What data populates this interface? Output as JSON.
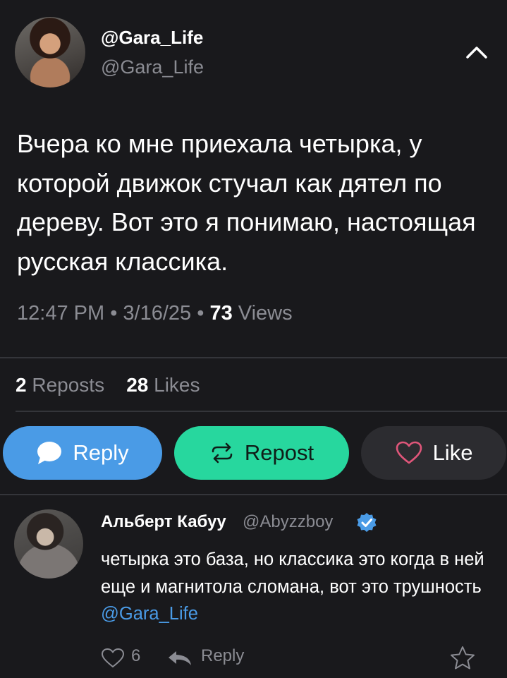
{
  "post": {
    "display_name": "@Gara_Life",
    "handle": "@Gara_Life",
    "text": "Вчера ко мне приехала четырка, у которой движок стучал как дятел по дереву. Вот это я понимаю, настоящая русская классика.",
    "time": "12:47 PM",
    "date": "3/16/25",
    "views_count": "73",
    "views_label": "Views",
    "separator": "•"
  },
  "stats": {
    "reposts_count": "2",
    "reposts_label": "Reposts",
    "likes_count": "28",
    "likes_label": "Likes"
  },
  "actions": {
    "reply_label": "Reply",
    "repost_label": "Repost",
    "like_label": "Like"
  },
  "comment": {
    "name": "Альберт Кабуу",
    "handle": "@Abyzzboy",
    "text_before_mention": "четырка это база, но классика это когда в ней еще и магнитола сломана, вот это трушность ",
    "mention": "@Gara_Life",
    "likes_count": "6",
    "reply_label": "Reply"
  },
  "icons": {
    "collapse": "chevron-up-icon",
    "reply": "speech-bubble-icon",
    "repost": "repost-arrows-icon",
    "like": "heart-icon",
    "verified": "verified-badge-icon",
    "comment_like": "heart-outline-icon",
    "comment_reply": "reply-arrow-icon",
    "favorite": "star-outline-icon"
  },
  "colors": {
    "background": "#19191c",
    "reply_button": "#4a9be6",
    "repost_button": "#27d79e",
    "like_button": "#2c2c30",
    "like_heart": "#e0567a",
    "mention": "#4a9be6",
    "muted_text": "#8b8c93"
  }
}
